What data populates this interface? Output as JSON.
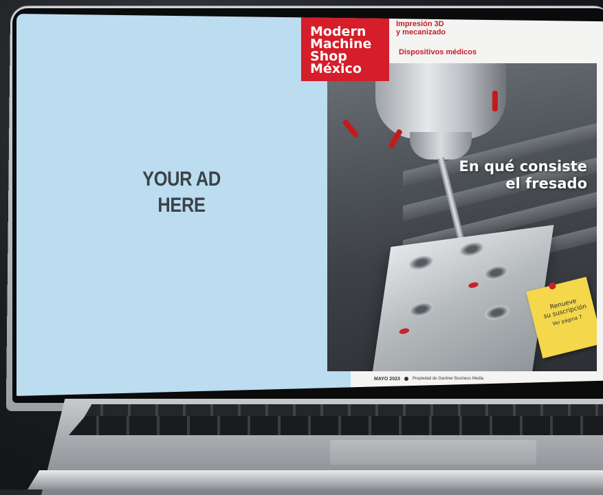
{
  "ad": {
    "line1": "YOUR AD",
    "line2": "HERE"
  },
  "cover": {
    "logo": {
      "line1": "Modern",
      "line2": "Machine",
      "line3": "Shop",
      "line4": "México"
    },
    "tagline1": {
      "line1": "Impresión 3D",
      "line2": "y mecanizado"
    },
    "tagline2": "Dispositivos médicos",
    "headline": {
      "line1": "En qué consiste",
      "line2": "el fresado"
    },
    "sticky_note": {
      "line1": "Renueve",
      "line2": "su suscripción",
      "line3": "Ver página 7"
    },
    "footer": {
      "date": "MAYO 2023",
      "publisher": "Propiedad de Gardner Business Media"
    }
  },
  "colors": {
    "brand_red": "#d51e29",
    "ad_background": "#bcdcf0",
    "sticky_yellow": "#f4d74a"
  }
}
